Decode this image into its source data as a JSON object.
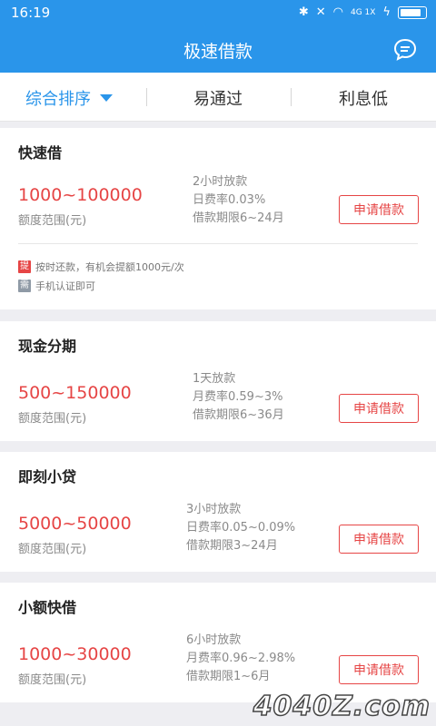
{
  "status": {
    "time": "16:19",
    "network": "4G 1X"
  },
  "header": {
    "title": "极速借款"
  },
  "filters": [
    {
      "label": "综合排序"
    },
    {
      "label": "易通过"
    },
    {
      "label": "利息低"
    }
  ],
  "products": [
    {
      "name": "快速借",
      "amount": "1000~100000",
      "range_label": "额度范围(元)",
      "details": [
        "2小时放款",
        "日费率0.03%",
        "借款期限6~24月"
      ],
      "apply_label": "申请借款",
      "notes": [
        {
          "tag": "提",
          "tag_color": "#e64545",
          "text": "按时还款，有机会提额1000元/次"
        },
        {
          "tag": "需",
          "tag_color": "#8f9aa6",
          "text": "手机认证即可"
        }
      ]
    },
    {
      "name": "现金分期",
      "amount": "500~150000",
      "range_label": "额度范围(元)",
      "details": [
        "1天放款",
        "月费率0.59~3%",
        "借款期限6~36月"
      ],
      "apply_label": "申请借款"
    },
    {
      "name": "即刻小贷",
      "amount": "5000~50000",
      "range_label": "额度范围(元)",
      "details": [
        "3小时放款",
        "日费率0.05~0.09%",
        "借款期限3~24月"
      ],
      "apply_label": "申请借款"
    },
    {
      "name": "小额快借",
      "amount": "1000~30000",
      "range_label": "额度范围(元)",
      "details": [
        "6小时放款",
        "月费率0.96~2.98%",
        "借款期限1~6月"
      ],
      "apply_label": "申请借款"
    }
  ],
  "watermark": "4040Z.com",
  "colors": {
    "accent": "#2a95ea",
    "primary_red": "#e64545"
  }
}
